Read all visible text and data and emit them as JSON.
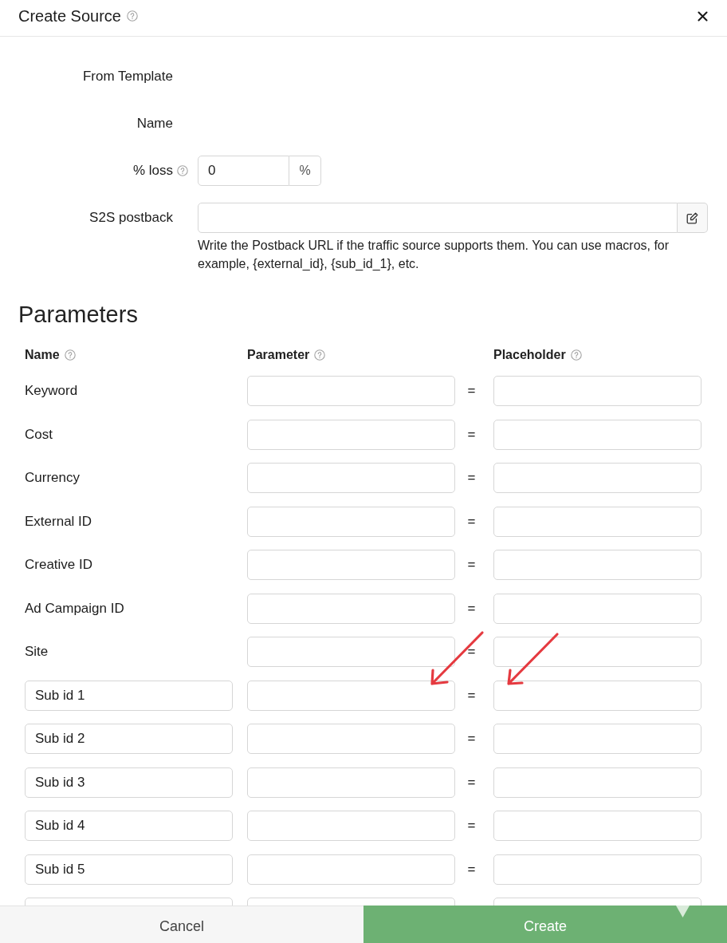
{
  "dialog": {
    "title": "Create Source",
    "help": true
  },
  "form": [
    {
      "kind": "label",
      "label": "From Template",
      "help": false
    },
    {
      "kind": "label",
      "label": "Name",
      "help": false
    },
    {
      "kind": "unit-input",
      "label": "% loss",
      "help": true,
      "value": "0",
      "unit": "%"
    },
    {
      "kind": "action-input",
      "label": "S2S postback",
      "help": false,
      "hint": "Write the Postback URL if the traffic source supports them. You can use macros, for example, {external_id}, {sub_id_1}, etc."
    }
  ],
  "parameters": {
    "title": "Parameters",
    "columns": [
      {
        "label": "Name",
        "help": true
      },
      {
        "label": "Parameter",
        "help": true
      },
      {
        "label": "Placeholder",
        "help": true
      }
    ],
    "rows": [
      {
        "kind": "fixed",
        "name": "Keyword",
        "equals": "="
      },
      {
        "kind": "fixed",
        "name": "Cost",
        "equals": "="
      },
      {
        "kind": "fixed",
        "name": "Currency",
        "equals": "="
      },
      {
        "kind": "fixed",
        "name": "External ID",
        "equals": "="
      },
      {
        "kind": "fixed",
        "name": "Creative ID",
        "equals": "="
      },
      {
        "kind": "fixed",
        "name": "Ad Campaign ID",
        "equals": "="
      },
      {
        "kind": "fixed",
        "name": "Site",
        "equals": "="
      },
      {
        "kind": "custom",
        "name": "Sub id 1",
        "equals": "="
      },
      {
        "kind": "custom",
        "name": "Sub id 2",
        "equals": "="
      },
      {
        "kind": "custom",
        "name": "Sub id 3",
        "equals": "="
      },
      {
        "kind": "custom",
        "name": "Sub id 4",
        "equals": "="
      },
      {
        "kind": "custom",
        "name": "Sub id 5",
        "equals": "="
      },
      {
        "kind": "custom"
      }
    ]
  },
  "overlays": [
    {
      "kind": "arrow"
    },
    {
      "kind": "arrow"
    },
    {
      "kind": "tooltip-tail"
    }
  ],
  "footer": [
    {
      "kind": "secondary",
      "label": "Cancel"
    },
    {
      "kind": "primary",
      "label": "Create"
    }
  ]
}
